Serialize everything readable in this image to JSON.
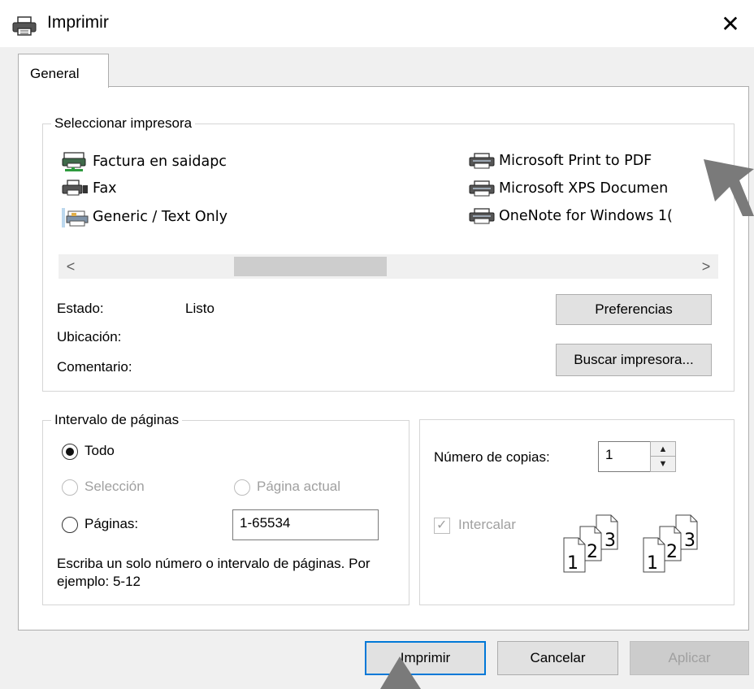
{
  "window": {
    "title": "Imprimir",
    "close_glyph": "✕",
    "icon": "printer-icon"
  },
  "tabs": [
    {
      "label": "General",
      "selected": true
    }
  ],
  "select_printer": {
    "legend": "Seleccionar impresora",
    "printers": [
      {
        "label": "Factura en saidapc",
        "icon": "network-printer-icon"
      },
      {
        "label": "Fax",
        "icon": "fax-icon"
      },
      {
        "label": "Generic / Text Only",
        "icon": "generic-printer-icon"
      },
      {
        "label": "Microsoft Print to PDF",
        "icon": "printer-icon"
      },
      {
        "label": "Microsoft XPS Documen",
        "icon": "printer-icon"
      },
      {
        "label": "OneNote for Windows 1(",
        "icon": "printer-icon"
      }
    ],
    "scroll_left": "<",
    "scroll_right": ">",
    "status_label": "Estado:",
    "status_value": "Listo",
    "location_label": "Ubicación:",
    "comment_label": "Comentario:",
    "preferences_button": "Preferencias",
    "find_printer_button": "Buscar impresora..."
  },
  "page_range": {
    "legend": "Intervalo de páginas",
    "all_label": "Todo",
    "selection_label": "Selección",
    "current_page_label": "Página actual",
    "pages_label": "Páginas:",
    "pages_value": "1-65534",
    "hint": "Escriba un solo número o intervalo de páginas. Por ejemplo: 5-12",
    "selected_option": "Todo"
  },
  "copies": {
    "label": "Número de copias:",
    "value": "1",
    "collate_label": "Intercalar",
    "collate_checked": true,
    "collate_enabled": false,
    "page_numbers": [
      "1",
      "2",
      "3"
    ]
  },
  "footer": {
    "print_button": "Imprimir",
    "cancel_button": "Cancelar",
    "apply_button": "Aplicar"
  },
  "colors": {
    "window_bg": "#f0f0f0",
    "panel_bg": "#ffffff",
    "default_button_border": "#0078d7",
    "disabled_text": "#a0a0a0",
    "cursor": "#7a7a7a"
  }
}
